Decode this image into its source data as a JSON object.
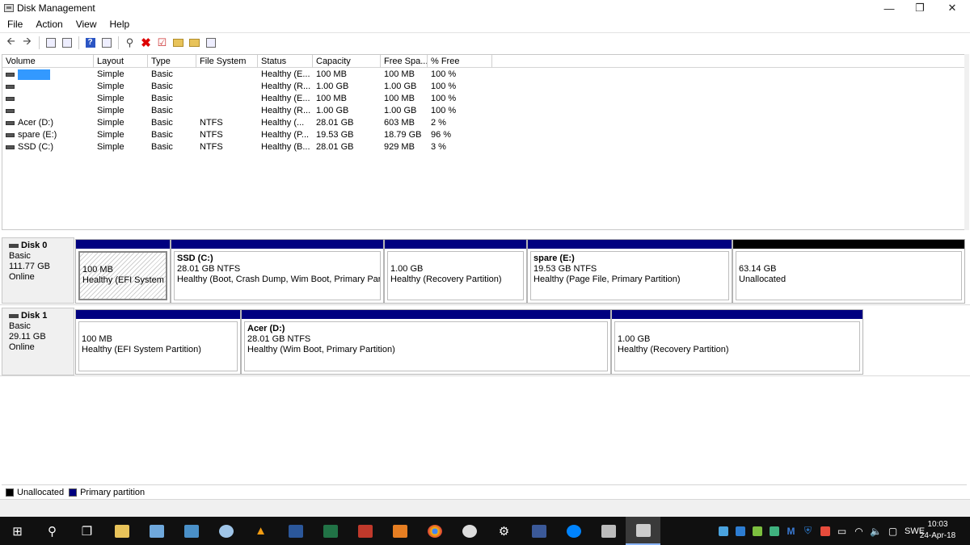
{
  "window": {
    "title": "Disk Management",
    "minimize": "—",
    "maximize": "❐",
    "close": "✕"
  },
  "menu": [
    "File",
    "Action",
    "View",
    "Help"
  ],
  "toolbar": {
    "back": "🡨",
    "forward": "🡪",
    "refresh": "⟲"
  },
  "columns": [
    "Volume",
    "Layout",
    "Type",
    "File System",
    "Status",
    "Capacity",
    "Free Spa...",
    "% Free"
  ],
  "volumes": [
    {
      "volume": "",
      "layout": "Simple",
      "type": "Basic",
      "fs": "",
      "status": "Healthy (E...",
      "capacity": "100 MB",
      "free": "100 MB",
      "pct": "100 %"
    },
    {
      "volume": "",
      "layout": "Simple",
      "type": "Basic",
      "fs": "",
      "status": "Healthy (R...",
      "capacity": "1.00 GB",
      "free": "1.00 GB",
      "pct": "100 %"
    },
    {
      "volume": "",
      "layout": "Simple",
      "type": "Basic",
      "fs": "",
      "status": "Healthy (E...",
      "capacity": "100 MB",
      "free": "100 MB",
      "pct": "100 %"
    },
    {
      "volume": "",
      "layout": "Simple",
      "type": "Basic",
      "fs": "",
      "status": "Healthy (R...",
      "capacity": "1.00 GB",
      "free": "1.00 GB",
      "pct": "100 %"
    },
    {
      "volume": "Acer (D:)",
      "layout": "Simple",
      "type": "Basic",
      "fs": "NTFS",
      "status": "Healthy (...",
      "capacity": "28.01 GB",
      "free": "603 MB",
      "pct": "2 %"
    },
    {
      "volume": "spare (E:)",
      "layout": "Simple",
      "type": "Basic",
      "fs": "NTFS",
      "status": "Healthy (P...",
      "capacity": "19.53 GB",
      "free": "18.79 GB",
      "pct": "96 %"
    },
    {
      "volume": "SSD (C:)",
      "layout": "Simple",
      "type": "Basic",
      "fs": "NTFS",
      "status": "Healthy (B...",
      "capacity": "28.01 GB",
      "free": "929 MB",
      "pct": "3 %"
    }
  ],
  "disks": [
    {
      "name": "Disk 0",
      "type": "Basic",
      "size": "111.77 GB",
      "state": "Online",
      "partitions": [
        {
          "name": "",
          "size": "100 MB",
          "status": "Healthy (EFI System Pa"
        },
        {
          "name": "SSD  (C:)",
          "size": "28.01 GB NTFS",
          "status": "Healthy (Boot, Crash Dump, Wim Boot, Primary Partiti"
        },
        {
          "name": "",
          "size": "1.00 GB",
          "status": "Healthy (Recovery Partition)"
        },
        {
          "name": "spare  (E:)",
          "size": "19.53 GB NTFS",
          "status": "Healthy (Page File, Primary Partition)"
        },
        {
          "name": "",
          "size": "63.14 GB",
          "status": "Unallocated"
        }
      ]
    },
    {
      "name": "Disk 1",
      "type": "Basic",
      "size": "29.11 GB",
      "state": "Online",
      "partitions": [
        {
          "name": "",
          "size": "100 MB",
          "status": "Healthy (EFI System Partition)"
        },
        {
          "name": "Acer  (D:)",
          "size": "28.01 GB NTFS",
          "status": "Healthy (Wim Boot, Primary Partition)"
        },
        {
          "name": "",
          "size": "1.00 GB",
          "status": "Healthy (Recovery Partition)"
        }
      ]
    }
  ],
  "legend": [
    {
      "label": "Unallocated",
      "color": "#000000"
    },
    {
      "label": "Primary partition",
      "color": "#000080"
    }
  ],
  "taskbar": {
    "language": "SWE",
    "time": "10:03",
    "date": "24-Apr-18"
  }
}
